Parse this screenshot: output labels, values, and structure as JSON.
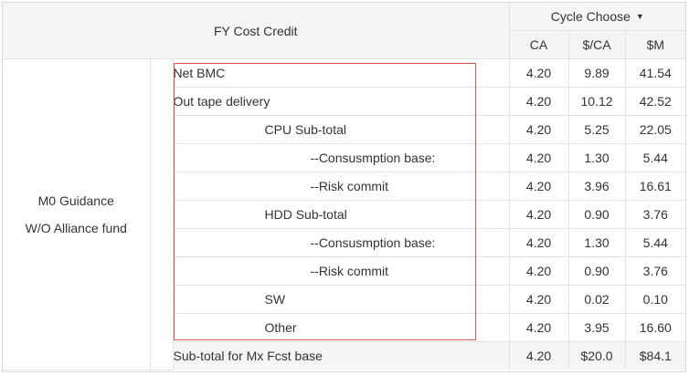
{
  "header": {
    "title": "FY Cost Credit",
    "cycle_label": "Cycle Choose",
    "columns": [
      "CA",
      "$/CA",
      "$M"
    ]
  },
  "group": {
    "line1": "M0 Guidance",
    "line2": "W/O Alliance fund"
  },
  "rows": [
    {
      "label": "Net BMC",
      "ca": "4.20",
      "per_ca": "9.89",
      "m": "41.54"
    },
    {
      "label": "Out tape delivery",
      "ca": "4.20",
      "per_ca": "10.12",
      "m": "42.52"
    },
    {
      "label": "CPU Sub-total",
      "ca": "4.20",
      "per_ca": "5.25",
      "m": "22.05"
    },
    {
      "label": "--Consusmption base:",
      "ca": "4.20",
      "per_ca": "1.30",
      "m": "5.44"
    },
    {
      "label": "--Risk commit",
      "ca": "4.20",
      "per_ca": "3.96",
      "m": "16.61"
    },
    {
      "label": "HDD Sub-total",
      "ca": "4.20",
      "per_ca": "0.90",
      "m": "3.76"
    },
    {
      "label": "--Consusmption base:",
      "ca": "4.20",
      "per_ca": "1.30",
      "m": "5.44"
    },
    {
      "label": "--Risk commit",
      "ca": "4.20",
      "per_ca": "0.90",
      "m": "3.76"
    },
    {
      "label": "SW",
      "ca": "4.20",
      "per_ca": "0.02",
      "m": "0.10"
    },
    {
      "label": "Other",
      "ca": "4.20",
      "per_ca": "3.95",
      "m": "16.60"
    }
  ],
  "subtotal": {
    "label": "Sub-total for Mx Fcst base",
    "ca": "4.20",
    "per_ca": "$20.0",
    "m": "$84.1"
  },
  "colors": {
    "highlight": "#d9534f",
    "header_bg": "#f5f5f5",
    "border": "#e3e3e3"
  }
}
